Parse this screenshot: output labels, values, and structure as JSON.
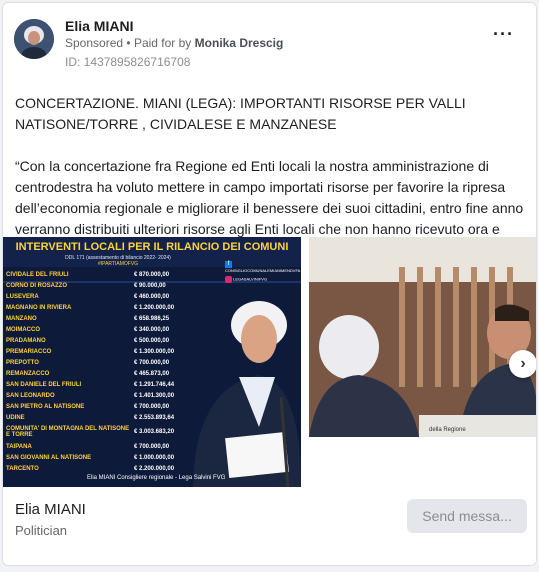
{
  "advertiser": {
    "name": "Elia MIANI",
    "sponsored_label": "Sponsored",
    "paid_for_prefix": "Paid for by",
    "payer": "Monika Drescig",
    "ad_id": "ID: 1437895826716708"
  },
  "post": {
    "headline": "CONCERTAZIONE. MIANI (LEGA): IMPORTANTI RISORSE PER VALLI NATISONE/TORRE , CIVIDALESE E MANZANESE",
    "body": "“Con la concertazione fra Regione ed Enti locali la nostra amministrazione di centrodestra ha voluto mettere in campo importati risorse per favorire la ripresa dell’economia regionale e migliorare il benessere dei suoi cittadini, entro fine anno verranno distribuiti ulteriori risorse agli Enti locali che non hanno ricevuto ora e a…"
  },
  "poster": {
    "title": "INTERVENTI LOCALI PER IL RILANCIO DEI COMUNI",
    "subtitle": "DDL 171 (assestamento di bilancio 2022- 2024)",
    "hashtag": "#IPARTIAMOFVG",
    "social1": "CONSIGLIOCOMUNALEMIANIMENDVFA",
    "social2": "LEGASALVINIFVG",
    "rows": [
      {
        "comune": "CIVIDALE DEL FRIULI",
        "importo": "€ 870.000,00"
      },
      {
        "comune": "CORNO DI ROSAZZO",
        "importo": "€ 90.000,00"
      },
      {
        "comune": "LUSEVERA",
        "importo": "€ 460.000,00"
      },
      {
        "comune": "MAGNANO IN RIVIERA",
        "importo": "€ 1.200.000,00"
      },
      {
        "comune": "MANZANO",
        "importo": "€ 658.986,25"
      },
      {
        "comune": "MOIMACCO",
        "importo": "€ 340.000,00"
      },
      {
        "comune": "PRADAMANO",
        "importo": "€ 500.000,00"
      },
      {
        "comune": "PREMARIACCO",
        "importo": "€ 1.300.000,00"
      },
      {
        "comune": "PREPOTTO",
        "importo": "€ 700.000,00"
      },
      {
        "comune": "REMANZACCO",
        "importo": "€ 465.873,00"
      },
      {
        "comune": "SAN DANIELE DEL FRIULI",
        "importo": "€ 1.291.746,44"
      },
      {
        "comune": "SAN LEONARDO",
        "importo": "€ 1.401.300,00"
      },
      {
        "comune": "SAN PIETRO AL NATISONE",
        "importo": "€ 700.000,00"
      },
      {
        "comune": "UDINE",
        "importo": "€ 2.553.893,64"
      },
      {
        "comune": "COMUNITA' DI MONTAGNA DEL NATISONE E TORRE",
        "importo": "€ 3.003.683,20"
      },
      {
        "comune": "TAIPANA",
        "importo": "€ 700.000,00"
      },
      {
        "comune": "SAN GIOVANNI AL NATISONE",
        "importo": "€ 1.000.000,00"
      },
      {
        "comune": "TARCENTO",
        "importo": "€ 2.200.000,00"
      }
    ],
    "footer": "Elia MIANI  Consigliere regionale - Lega Salvini FVG"
  },
  "photo2": {
    "sign": "della Regione"
  },
  "footer": {
    "name": "Elia MIANI",
    "category": "Politician",
    "button_label": "Send messa..."
  },
  "icons": [
    "more-options-icon",
    "chevron-right-icon",
    "facebook-icon",
    "instagram-icon"
  ],
  "colors": {
    "poster_bg": "#0d1a3a",
    "poster_title": "#ffd23a",
    "button_bg": "#e4e6eb"
  }
}
